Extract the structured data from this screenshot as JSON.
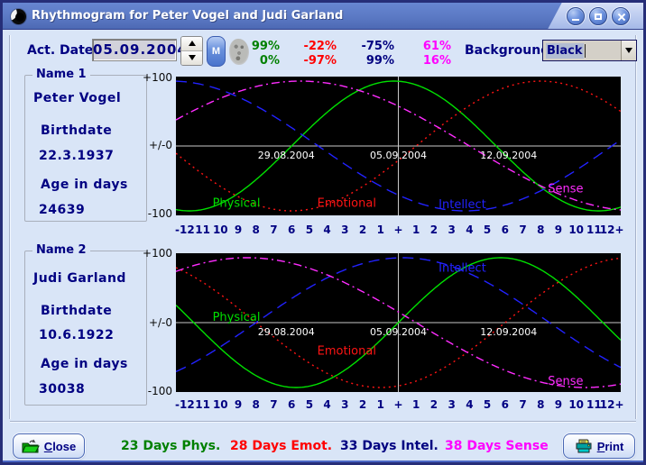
{
  "window": {
    "title": "Rhythmogram for Peter Vogel and Judi Garland",
    "control_icons": [
      "minimize-icon",
      "maximize-icon",
      "close-icon"
    ]
  },
  "colors": {
    "navy_text": "#000082",
    "window_background": "#d9e5f7",
    "titlebar_blue": "#5b79c4",
    "chart_background": "#000000",
    "chart_axis": "#c8c8c8"
  },
  "toolbar": {
    "act_date_label": "Act. Date",
    "act_date_value": "05.09.2004",
    "m_button_label": "M",
    "background_label": "Background",
    "background_value": "Black",
    "readout_rows": [
      [
        "99%",
        "-22%",
        "-75%",
        "61%"
      ],
      [
        "0%",
        "-97%",
        "99%",
        "16%"
      ]
    ],
    "readout_colors": [
      "#008000",
      "#ff0000",
      "#000080",
      "#ff00ff"
    ]
  },
  "person1": {
    "group_label": "Name 1",
    "name": "Peter Vogel",
    "birthdate_label": "Birthdate",
    "birthdate": "22.3.1937",
    "age_label": "Age in days",
    "age_days": "24639"
  },
  "person2": {
    "group_label": "Name 2",
    "name": "Judi Garland",
    "birthdate_label": "Birthdate",
    "birthdate": "10.6.1922",
    "age_label": "Age in days",
    "age_days": "30038"
  },
  "axis": {
    "y_top": "+100",
    "y_mid": "+/-0",
    "y_bottom": "-100",
    "x_ticks": [
      "-12",
      "11",
      "10",
      "9",
      "8",
      "7",
      "6",
      "5",
      "4",
      "3",
      "2",
      "1",
      "+",
      "1",
      "2",
      "3",
      "4",
      "5",
      "6",
      "7",
      "8",
      "9",
      "10",
      "11",
      "12+"
    ]
  },
  "chart_data": [
    {
      "type": "line",
      "person": "Peter Vogel",
      "x_range_days": [
        -12.5,
        12.5
      ],
      "ylim": [
        -100,
        100
      ],
      "grid": false,
      "bg": "#000000",
      "axis_color": "#c8c8c8",
      "center_date": "05.09.2004",
      "date_labels": [
        {
          "text": "29.08.2004",
          "day": -6.3
        },
        {
          "text": "05.09.2004",
          "day": 0
        },
        {
          "text": "12.09.2004",
          "day": 6.2
        }
      ],
      "series": [
        {
          "name": "Physical",
          "period_days": 23,
          "day_in_cycle": 6,
          "today_value_pct": 99,
          "color": "#00e000",
          "dash": "",
          "label": {
            "day": -9.1,
            "pct": -88
          }
        },
        {
          "name": "Emotional",
          "period_days": 28,
          "day_in_cycle": 27,
          "today_value_pct": -22,
          "color": "#ff1414",
          "dash": "2,4",
          "label": {
            "day": -2.9,
            "pct": -88
          }
        },
        {
          "name": "Intellect",
          "period_days": 33,
          "day_in_cycle": 21,
          "today_value_pct": -75,
          "color": "#2222ff",
          "dash": "12,7",
          "label": {
            "day": 3.6,
            "pct": -90
          }
        },
        {
          "name": "Sense",
          "period_days": 38,
          "day_in_cycle": 15,
          "today_value_pct": 61,
          "color": "#ff2cff",
          "dash": "9,4,2,4",
          "label": {
            "day": 9.4,
            "pct": -66
          }
        }
      ]
    },
    {
      "type": "line",
      "person": "Judi Garland",
      "x_range_days": [
        -12.5,
        12.5
      ],
      "ylim": [
        -100,
        100
      ],
      "grid": false,
      "bg": "#000000",
      "axis_color": "#c8c8c8",
      "center_date": "05.09.2004",
      "date_labels": [
        {
          "text": "29.08.2004",
          "day": -6.3
        },
        {
          "text": "05.09.2004",
          "day": 0
        },
        {
          "text": "12.09.2004",
          "day": 6.2
        }
      ],
      "series": [
        {
          "name": "Physical",
          "period_days": 23,
          "day_in_cycle": 0,
          "today_value_pct": 0,
          "color": "#00e000",
          "dash": "",
          "label": {
            "day": -9.1,
            "pct": 8
          }
        },
        {
          "name": "Emotional",
          "period_days": 28,
          "day_in_cycle": 22,
          "today_value_pct": -97,
          "color": "#ff1414",
          "dash": "2,4",
          "label": {
            "day": -2.9,
            "pct": -44
          }
        },
        {
          "name": "Intellect",
          "period_days": 33,
          "day_in_cycle": 8,
          "today_value_pct": 99,
          "color": "#2222ff",
          "dash": "12,7",
          "label": {
            "day": 3.6,
            "pct": 84
          }
        },
        {
          "name": "Sense",
          "period_days": 38,
          "day_in_cycle": 18,
          "today_value_pct": 16,
          "color": "#ff2cff",
          "dash": "9,4,2,4",
          "label": {
            "day": 9.4,
            "pct": -90
          }
        }
      ]
    }
  ],
  "footer": {
    "close_label": "Close",
    "print_label": "Print",
    "legend": [
      {
        "text": "23 Days Phys.",
        "color": "#008000"
      },
      {
        "text": "28 Days Emot.",
        "color": "#ff0000"
      },
      {
        "text": "33 Days Intel.",
        "color": "#000080"
      },
      {
        "text": "38 Days Sense",
        "color": "#ff00ff"
      }
    ]
  }
}
